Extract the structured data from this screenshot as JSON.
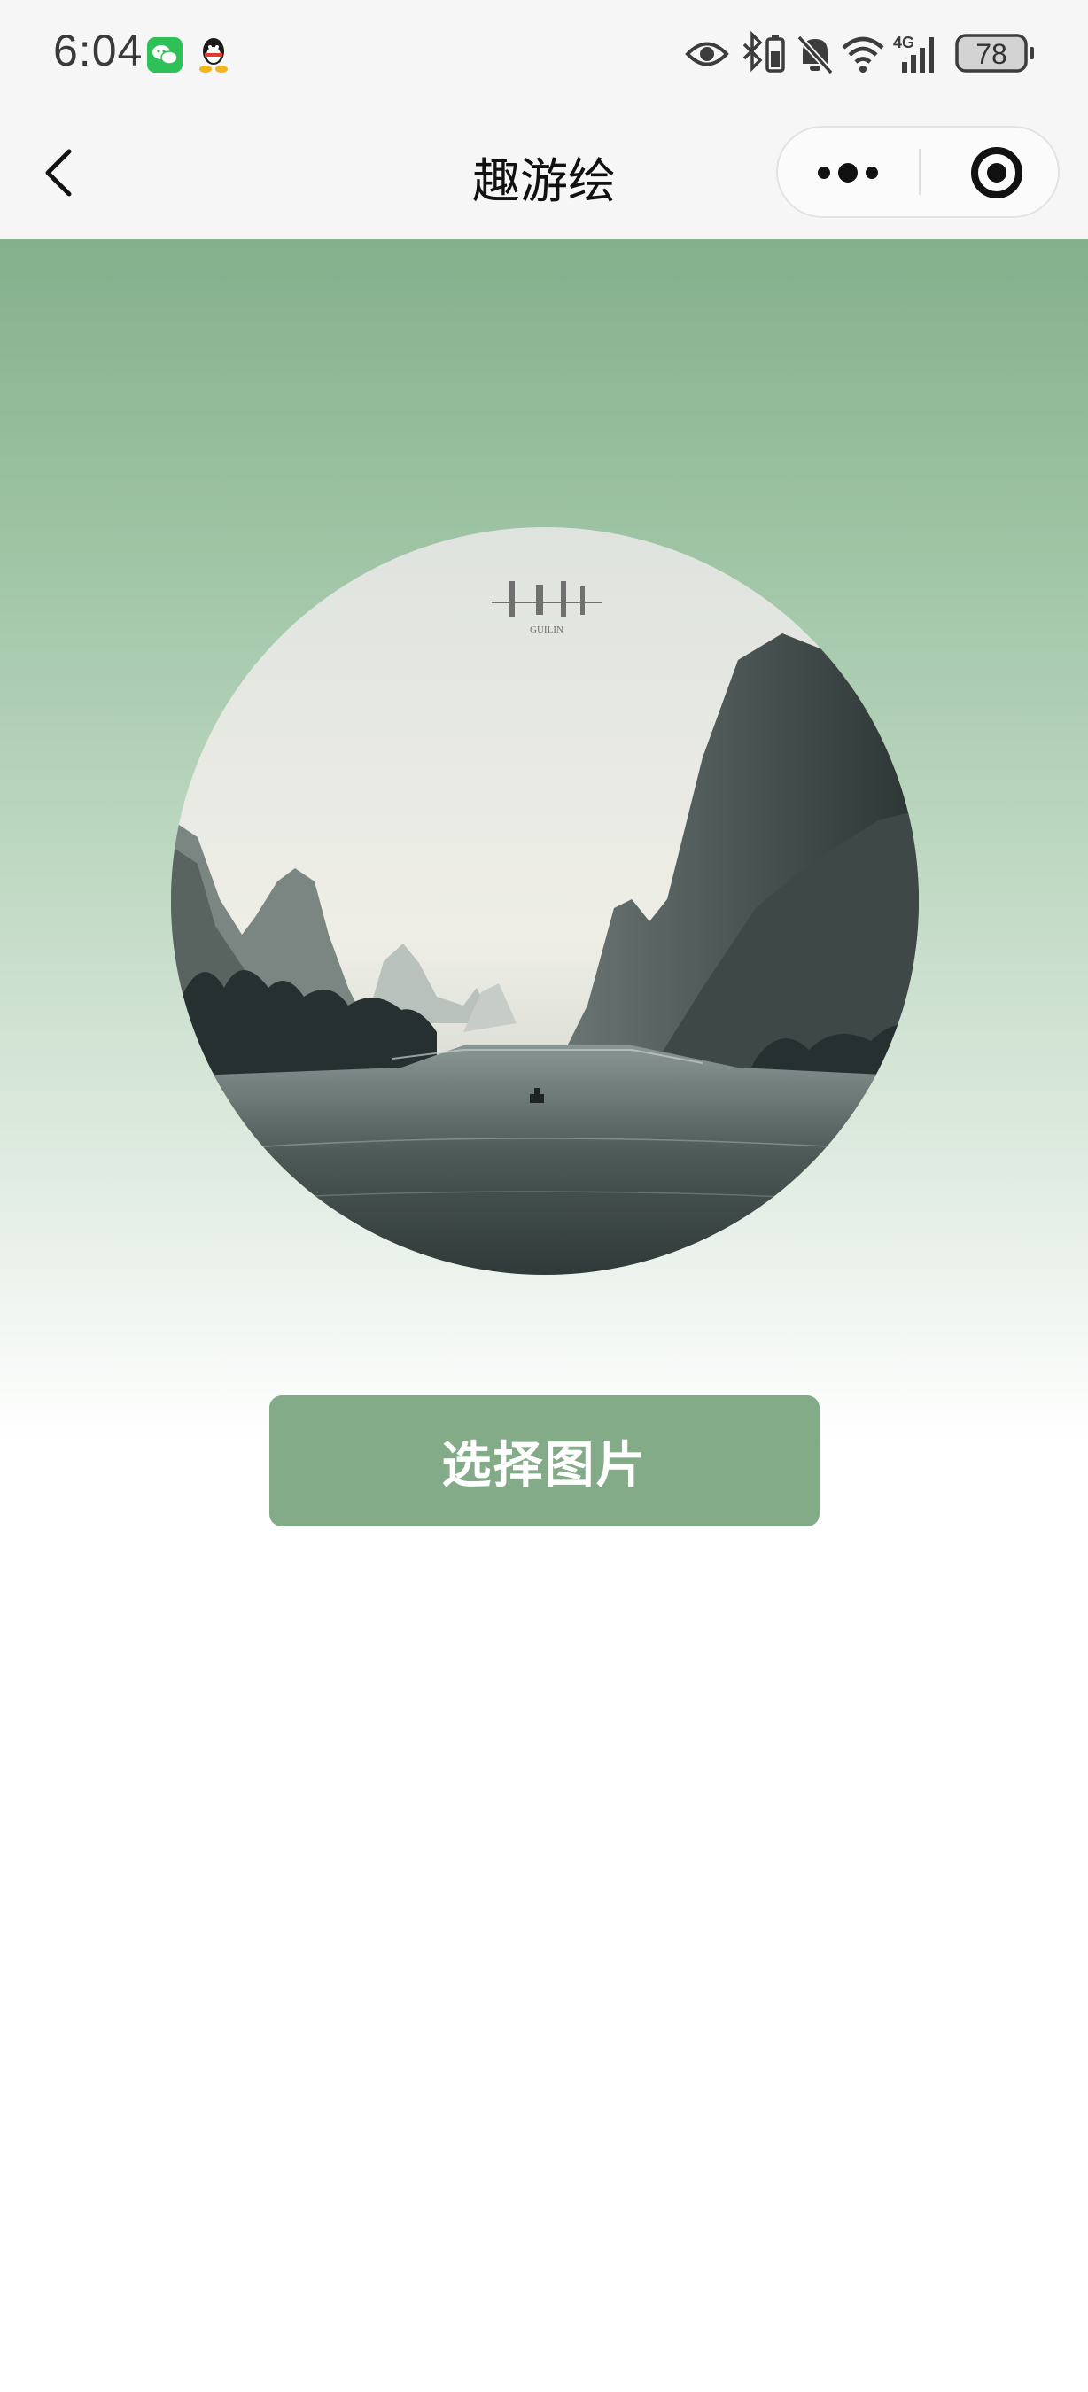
{
  "status_bar": {
    "time": "6:04",
    "battery_level": "78",
    "network_type": "4G",
    "icons": [
      "wechat-icon",
      "qq-icon",
      "eye-icon",
      "bluetooth-icon",
      "vibrate-icon",
      "mute-bell-icon",
      "wifi-icon",
      "signal-icon",
      "battery-icon"
    ]
  },
  "nav": {
    "title": "趣游绘",
    "back_icon": "chevron-left-icon",
    "more_icon": "more-dots-icon",
    "close_icon": "target-close-icon"
  },
  "main": {
    "photo": {
      "watermark_text": "GUILIN",
      "alt_icon": "landscape-photo"
    },
    "select_button_label": "选择图片"
  },
  "colors": {
    "accent": "#84ab88",
    "gradient_top": "#84b08c",
    "background": "#ffffff"
  }
}
